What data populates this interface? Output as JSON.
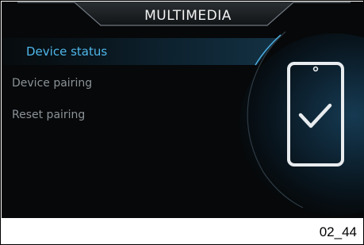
{
  "header": {
    "title": "MULTIMEDIA"
  },
  "menu": {
    "items": [
      {
        "label": "Device status",
        "selected": true
      },
      {
        "label": "Device pairing",
        "selected": false
      },
      {
        "label": "Reset pairing",
        "selected": false
      }
    ]
  },
  "illustration": {
    "icon": "smartphone-check-icon"
  },
  "colors": {
    "accent": "#4fb6ea",
    "background": "#060809",
    "text_inactive": "#8c9297",
    "title": "#f2f2f2"
  },
  "footer": {
    "code": "02_44"
  }
}
